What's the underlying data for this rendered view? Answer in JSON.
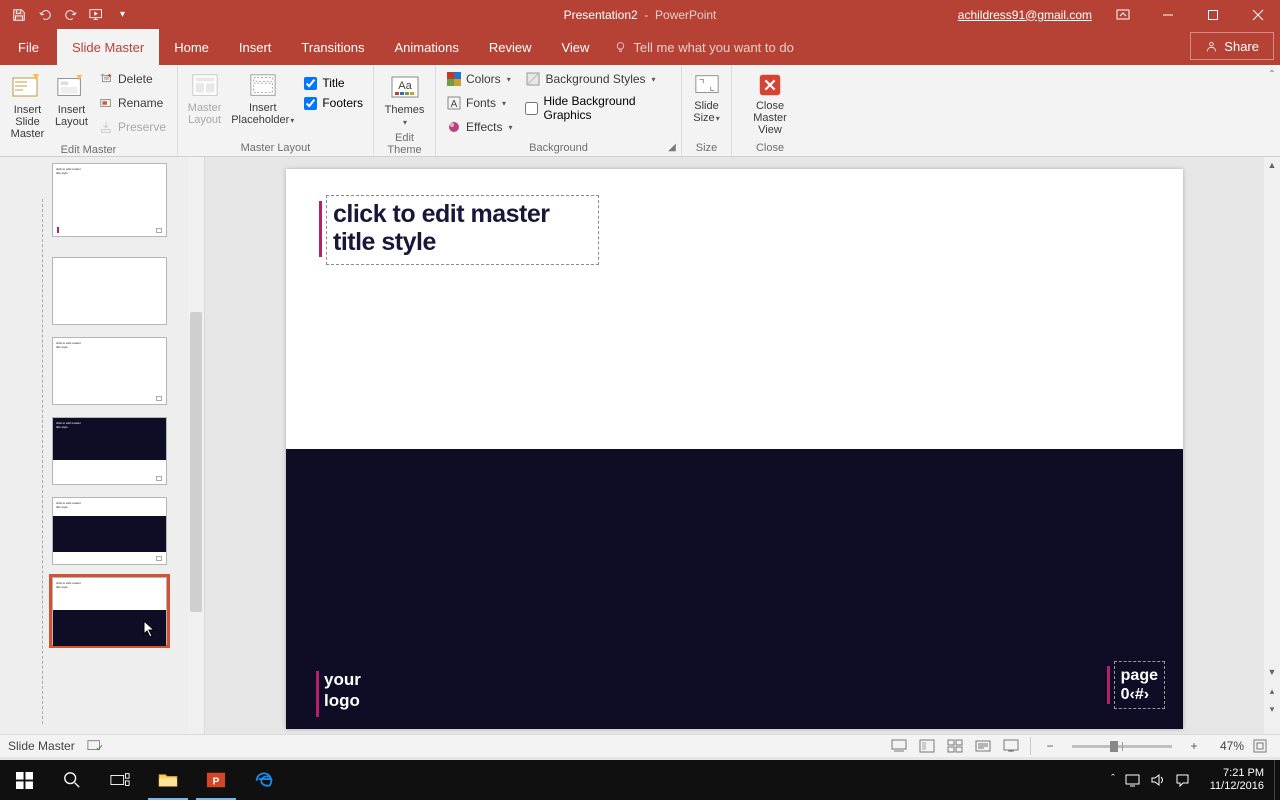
{
  "titlebar": {
    "doc_name": "Presentation2",
    "app_name": "PowerPoint",
    "user": "achildress91@gmail.com"
  },
  "tabs": {
    "file": "File",
    "slide_master": "Slide Master",
    "home": "Home",
    "insert": "Insert",
    "transitions": "Transitions",
    "animations": "Animations",
    "review": "Review",
    "view": "View",
    "tellme": "Tell me what you want to do",
    "share": "Share"
  },
  "ribbon": {
    "edit_master": {
      "label": "Edit Master",
      "insert_slide_master": "Insert Slide\nMaster",
      "insert_layout": "Insert\nLayout",
      "delete": "Delete",
      "rename": "Rename",
      "preserve": "Preserve"
    },
    "master_layout": {
      "label": "Master Layout",
      "master_layout_btn": "Master\nLayout",
      "insert_placeholder": "Insert\nPlaceholder",
      "title_chk": "Title",
      "footers_chk": "Footers"
    },
    "edit_theme": {
      "label": "Edit Theme",
      "themes": "Themes"
    },
    "background": {
      "label": "Background",
      "colors": "Colors",
      "fonts": "Fonts",
      "effects": "Effects",
      "bg_styles": "Background Styles",
      "hide_bg": "Hide Background Graphics"
    },
    "size": {
      "label": "Size",
      "slide_size": "Slide\nSize"
    },
    "close": {
      "label": "Close",
      "close_master": "Close\nMaster View"
    }
  },
  "slide": {
    "title_placeholder": "click to edit master title style",
    "logo": "your\nlogo",
    "page_label": "page",
    "page_num": "0‹#›"
  },
  "status": {
    "view": "Slide Master",
    "zoom": "47%"
  },
  "clock": {
    "time": "7:21 PM",
    "date": "11/12/2016"
  }
}
